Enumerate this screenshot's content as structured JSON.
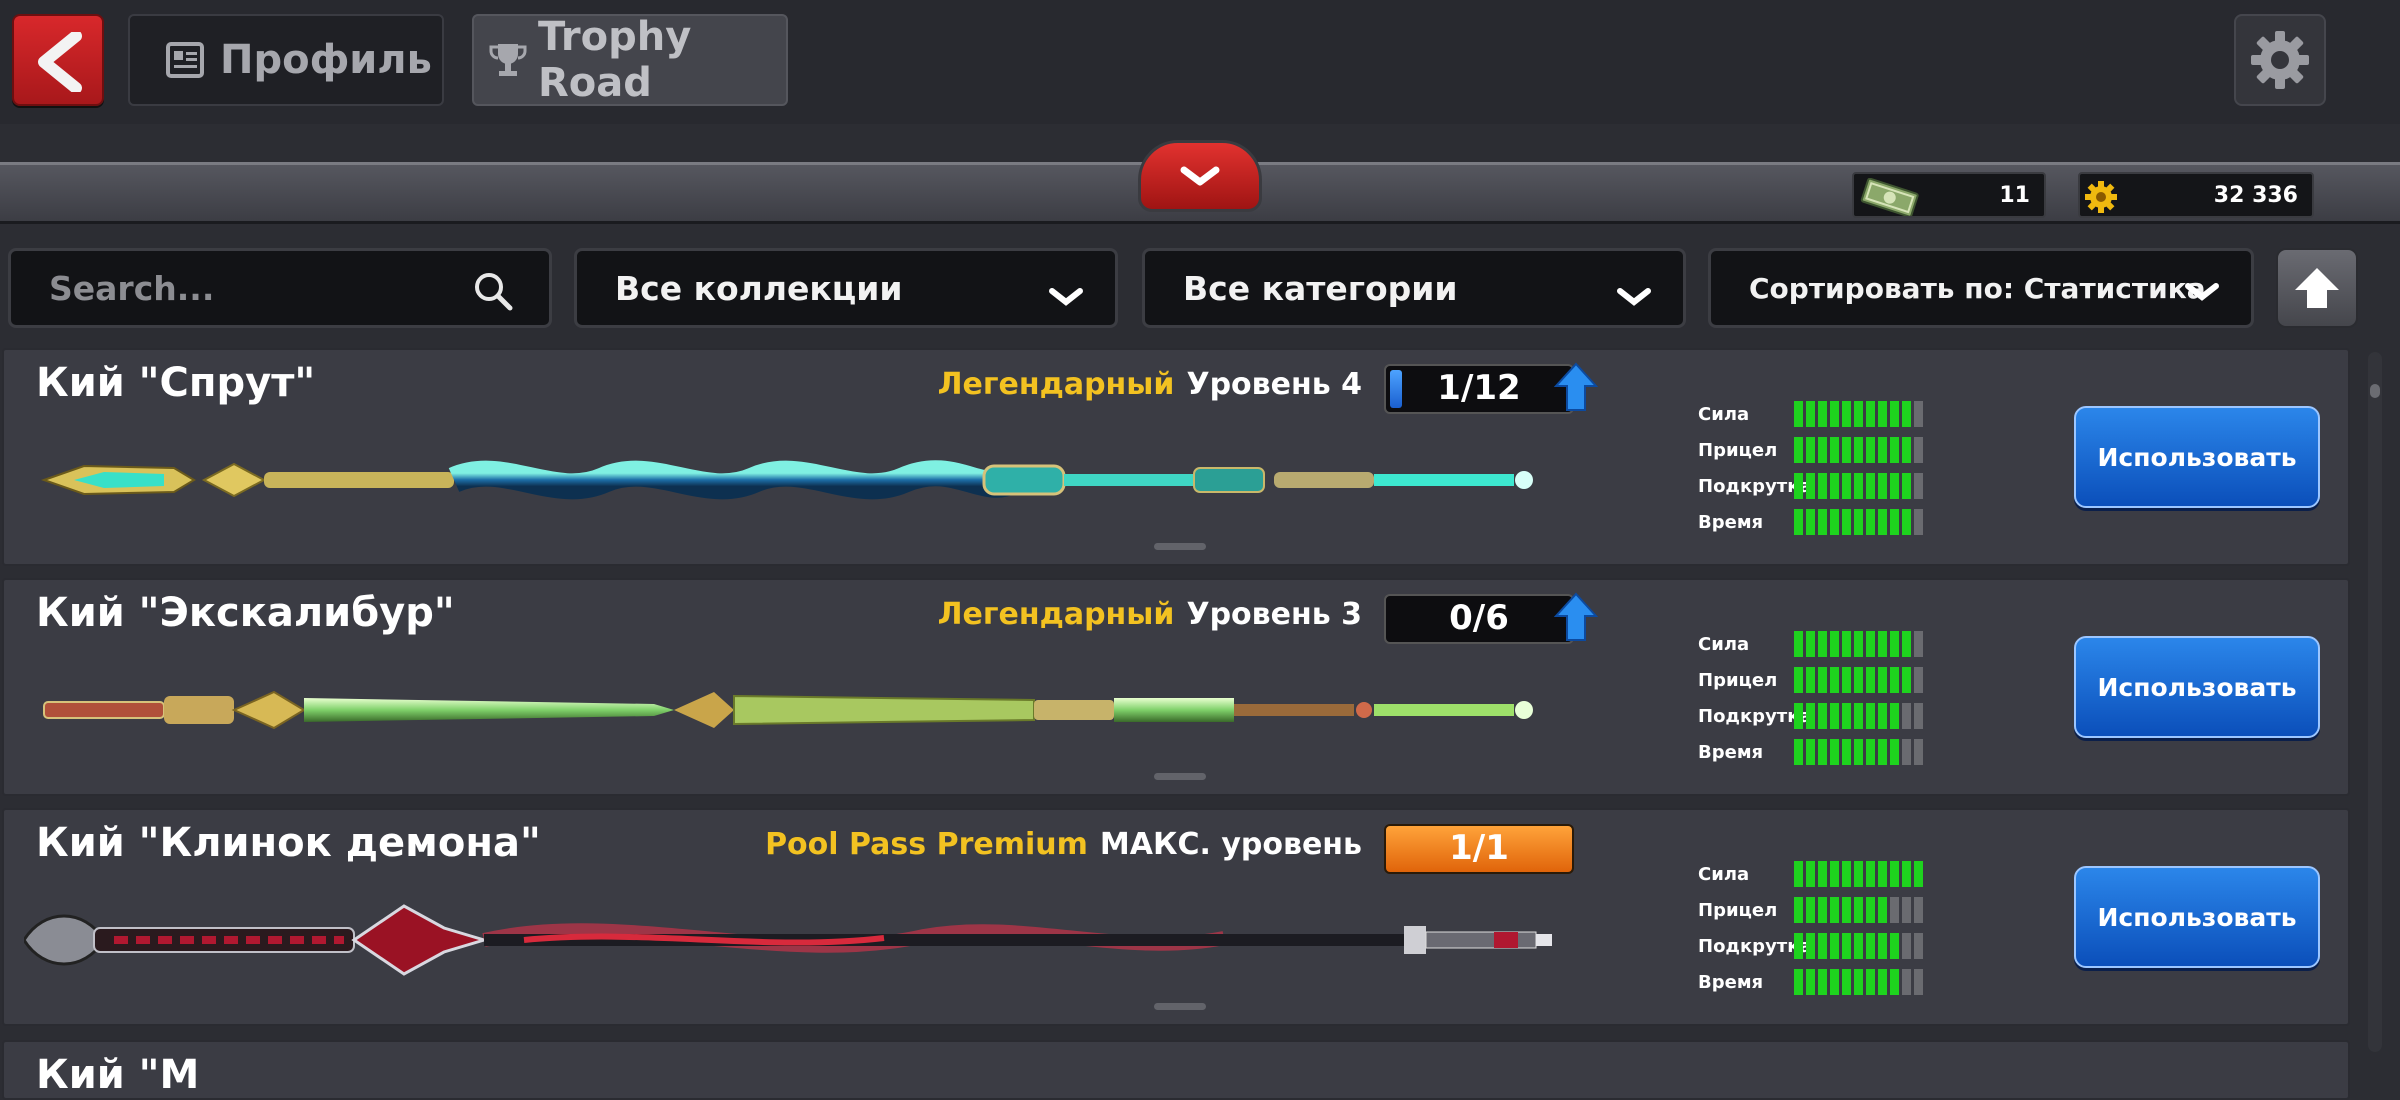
{
  "header": {
    "profile_tab": "Профиль",
    "trophy_tab": "Trophy Road"
  },
  "currency": {
    "cash": "11",
    "coins": "32 336"
  },
  "filters": {
    "search_placeholder": "Search...",
    "collections": "Все коллекции",
    "categories": "Все категории",
    "sort": "Сортировать по: Статистика"
  },
  "stat_labels": [
    "Сила",
    "Прицел",
    "Подкрутка",
    "Время"
  ],
  "cues": [
    {
      "name": "Кий \"Спрут\"",
      "rarity": "Легендарный",
      "level": "Уровень 4",
      "progress": "1/12",
      "progress_fraction": 0.0833,
      "stats": [
        10,
        10,
        10,
        10
      ],
      "button": "Использовать"
    },
    {
      "name": "Кий \"Экскалибур\"",
      "rarity": "Легендарный",
      "level": "Уровень 3",
      "progress": "0/6",
      "progress_fraction": 0,
      "stats": [
        10,
        10,
        9,
        9
      ],
      "button": "Использовать"
    },
    {
      "name": "Кий \"Клинок демона\"",
      "rarity": "Pool Pass Premium",
      "level": "МАКС. уровень",
      "progress": "1/1",
      "progress_fraction": 1,
      "stats": [
        11,
        8,
        9,
        9
      ],
      "button": "Использовать"
    }
  ],
  "partial_cue": {
    "name": "Кий \"М"
  },
  "colors": {
    "rarity": "#f3c221",
    "stat_on": "#1ed31e",
    "use_button": "#1a6ad8",
    "back_button": "#c8201f"
  }
}
